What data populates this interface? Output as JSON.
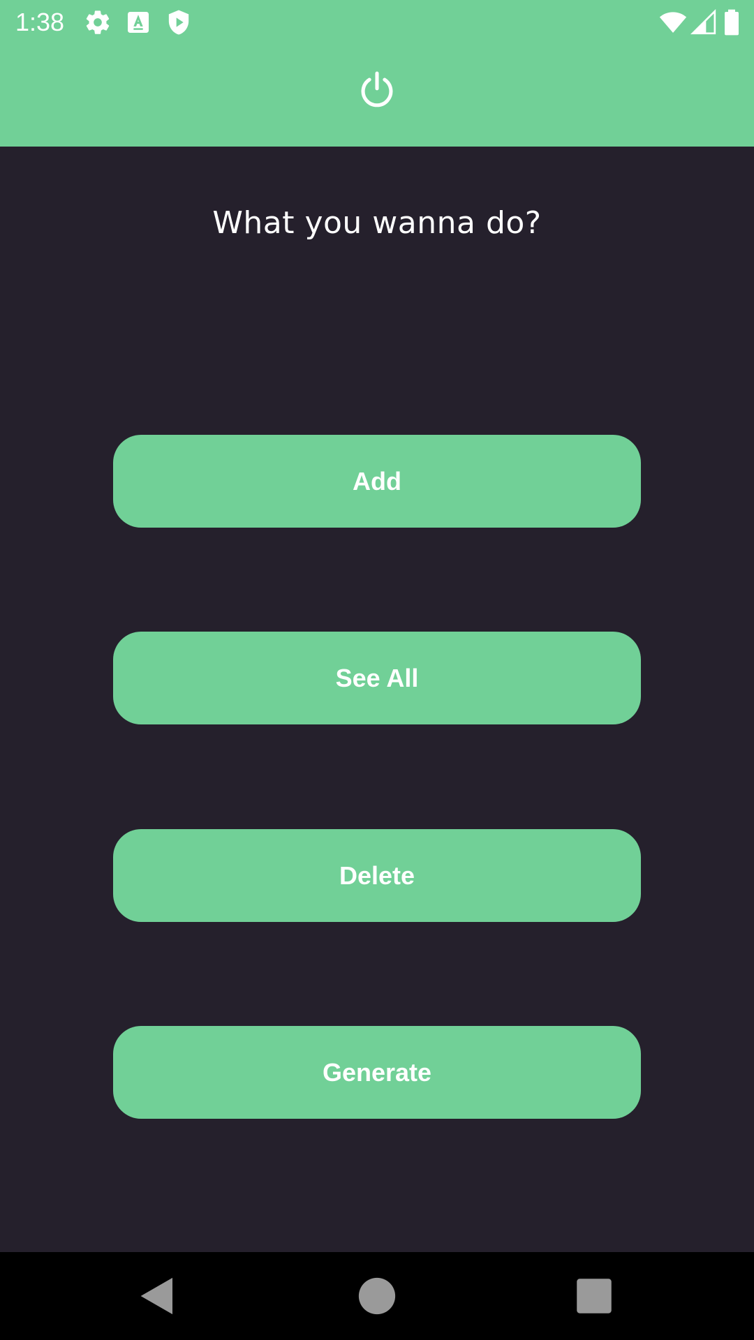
{
  "status_bar": {
    "time": "1:38",
    "icons": [
      "settings-icon",
      "font-a-icon",
      "shield-play-icon",
      "wifi-icon",
      "cell-signal-icon",
      "battery-icon"
    ]
  },
  "header": {
    "power_icon": "power-icon",
    "background_color": "#71d097"
  },
  "main": {
    "title": "What you wanna do?",
    "background_color": "#25202c",
    "buttons": [
      {
        "label": "Add"
      },
      {
        "label": "See All"
      },
      {
        "label": "Delete"
      },
      {
        "label": "Generate"
      }
    ],
    "button_color": "#71d097"
  },
  "nav_bar": {
    "buttons": [
      "back-icon",
      "home-icon",
      "recents-icon"
    ]
  }
}
